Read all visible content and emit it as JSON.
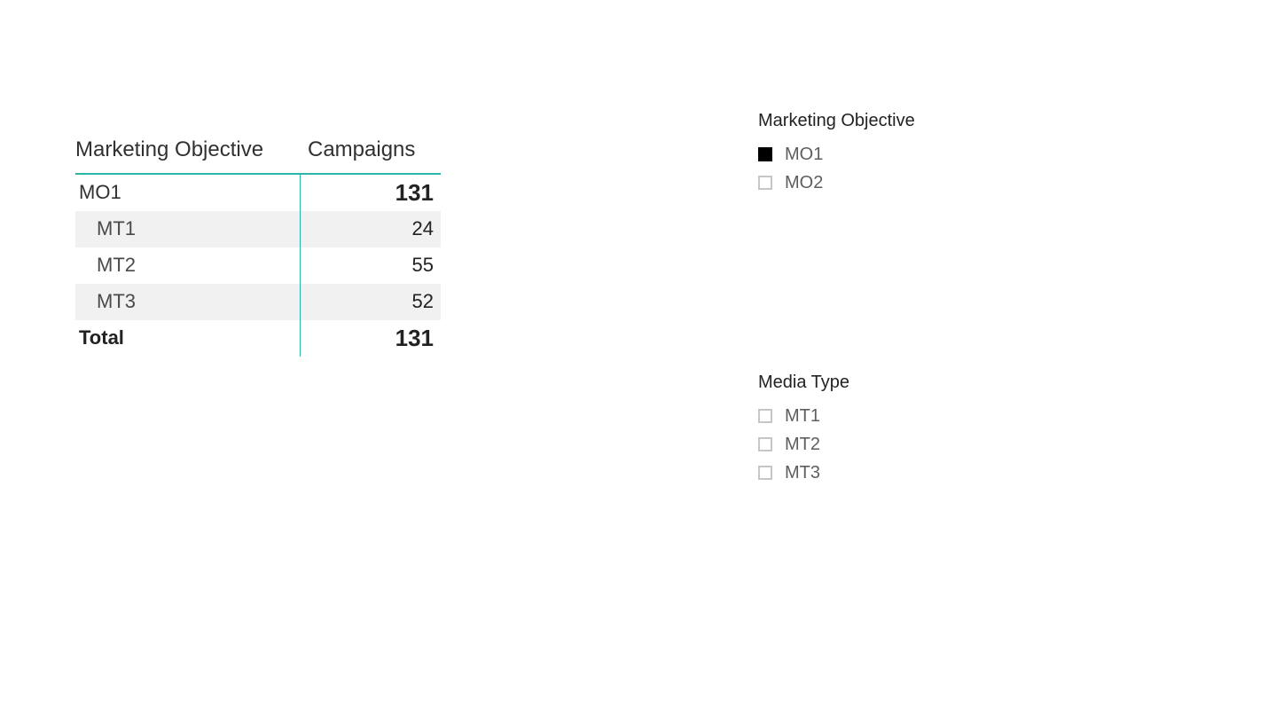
{
  "matrix": {
    "headers": {
      "label": "Marketing Objective",
      "value": "Campaigns"
    },
    "rows": [
      {
        "kind": "parent",
        "label": "MO1",
        "value": "131"
      },
      {
        "kind": "child",
        "label": "MT1",
        "value": "24",
        "alt": true
      },
      {
        "kind": "child",
        "label": "MT2",
        "value": "55",
        "alt": false
      },
      {
        "kind": "child",
        "label": "MT3",
        "value": "52",
        "alt": true
      }
    ],
    "total": {
      "label": "Total",
      "value": "131"
    }
  },
  "slicers": {
    "objective": {
      "title": "Marketing Objective",
      "items": [
        {
          "label": "MO1",
          "checked": true
        },
        {
          "label": "MO2",
          "checked": false
        }
      ]
    },
    "media": {
      "title": "Media Type",
      "items": [
        {
          "label": "MT1",
          "checked": false
        },
        {
          "label": "MT2",
          "checked": false
        },
        {
          "label": "MT3",
          "checked": false
        }
      ]
    }
  }
}
